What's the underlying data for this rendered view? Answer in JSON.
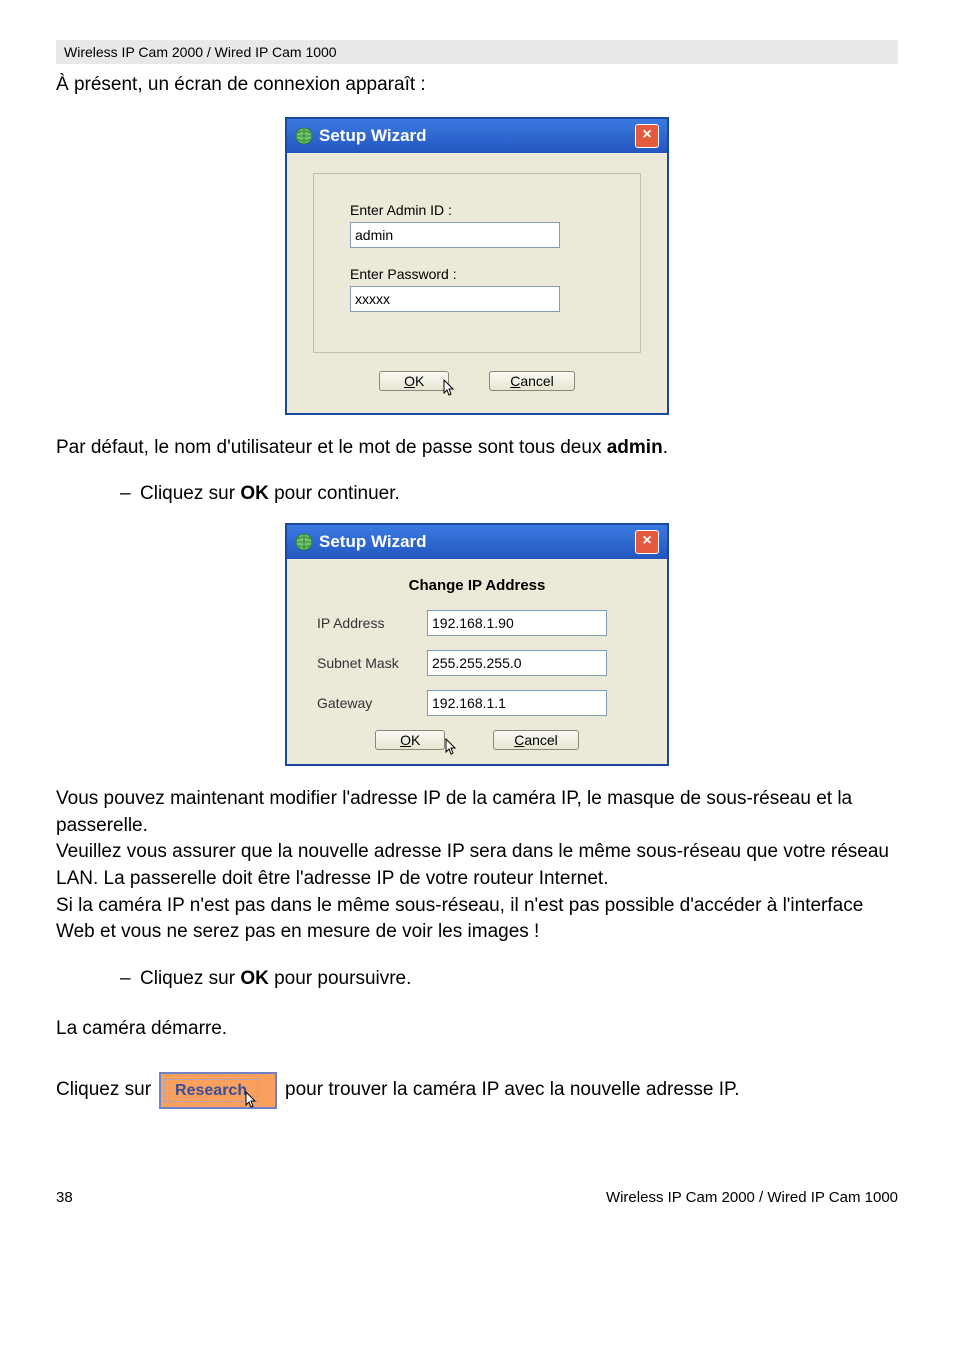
{
  "header": {
    "product_line": "Wireless IP Cam 2000 / Wired IP Cam 1000"
  },
  "intro": {
    "line1": "À présent, un écran de connexion apparaît :"
  },
  "dialog1": {
    "title": "Setup Wizard",
    "close_name": "close-icon",
    "admin_id_label": "Enter Admin ID :",
    "admin_id_value": "admin",
    "password_label": "Enter Password :",
    "password_value": "xxxxx",
    "ok_label": "OK",
    "ok_accel": "O",
    "cancel_label": "Cancel",
    "cancel_accel": "C"
  },
  "para_default": {
    "prefix": "Par défaut, le nom d'utilisateur et le mot de passe sont tous deux ",
    "bold": "admin",
    "suffix": "."
  },
  "bullet1": {
    "dash": "–",
    "prefix": "Cliquez sur ",
    "bold": "OK",
    "suffix": " pour continuer."
  },
  "dialog2": {
    "title": "Setup Wizard",
    "section_title": "Change IP Address",
    "ip_label": "IP Address",
    "ip_value": "192.168.1.90",
    "mask_label": "Subnet Mask",
    "mask_value": "255.255.255.0",
    "gw_label": "Gateway",
    "gw_value": "192.168.1.1",
    "ok_label": "OK",
    "cancel_label": "Cancel"
  },
  "para_block": {
    "p1": "Vous pouvez maintenant modifier l'adresse IP de la caméra IP, le masque de sous-réseau et la passerelle.",
    "p2": "Veuillez vous assurer que la nouvelle adresse IP sera dans le même sous-réseau que votre réseau LAN. La passerelle doit être l'adresse IP de votre routeur Internet.",
    "p3": "Si la caméra IP n'est pas dans le même sous-réseau, il n'est pas possible d'accéder à l'interface Web et vous ne serez pas en mesure de voir les images !"
  },
  "bullet2": {
    "dash": "–",
    "prefix": "Cliquez sur ",
    "bold": "OK",
    "suffix": " pour poursuivre."
  },
  "camera_start": "La caméra démarre.",
  "research": {
    "prefix": "Cliquez sur",
    "btn_label": "Research",
    "suffix": "pour trouver la caméra IP avec la nouvelle adresse IP."
  },
  "footer": {
    "page": "38",
    "right": "Wireless IP Cam 2000 / Wired IP Cam 1000"
  }
}
